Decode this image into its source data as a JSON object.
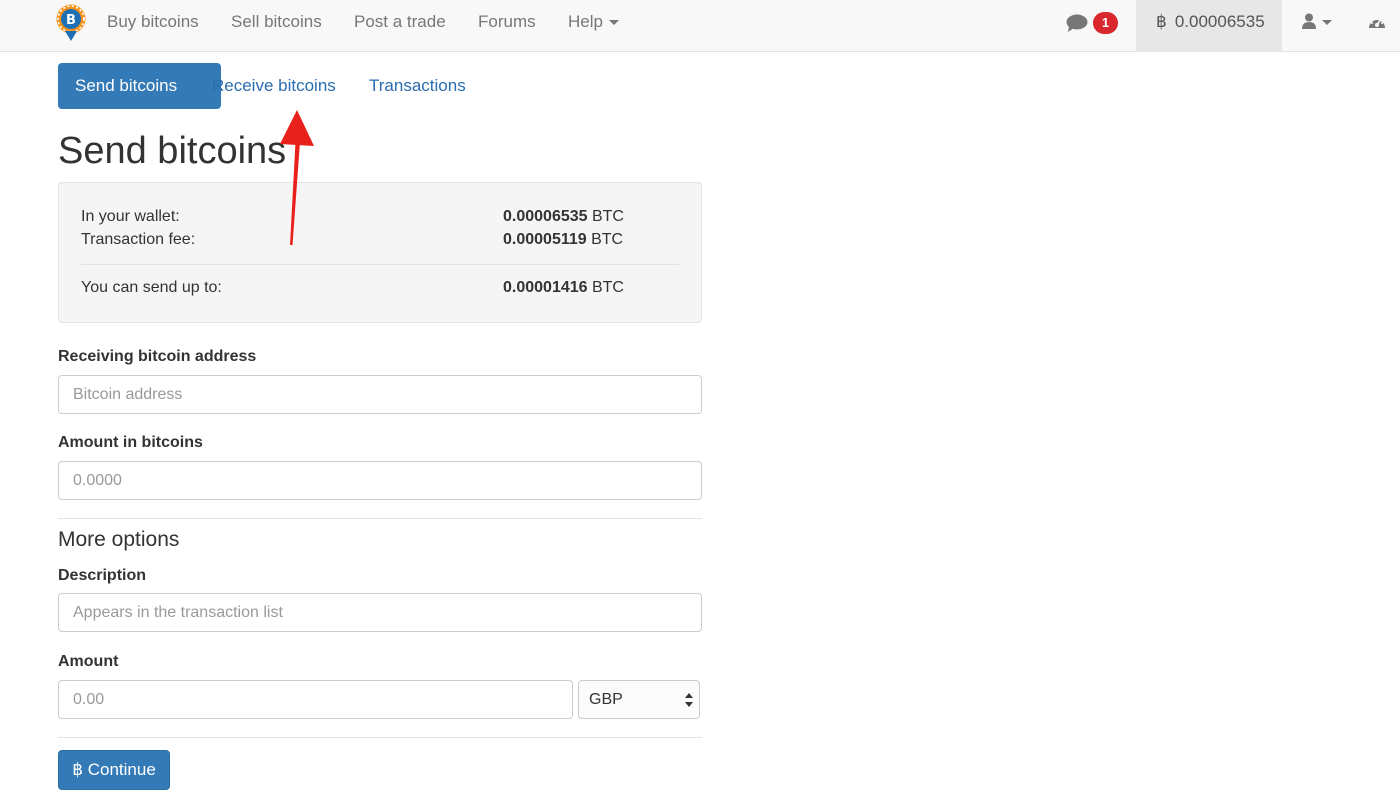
{
  "navbar": {
    "items": [
      {
        "label": "Buy bitcoins"
      },
      {
        "label": "Sell bitcoins"
      },
      {
        "label": "Post a trade"
      },
      {
        "label": "Forums"
      },
      {
        "label": "Help"
      }
    ],
    "messages_count": "1",
    "wallet_balance": "0.00006535",
    "wallet_symbol": "฿"
  },
  "pills": {
    "send": "Send bitcoins",
    "receive": "Receive bitcoins",
    "transactions": "Transactions"
  },
  "page_title": "Send bitcoins",
  "wallet": {
    "in_wallet_label": "In your wallet:",
    "in_wallet_amount": "0.00006535",
    "fee_label": "Transaction fee:",
    "fee_amount": "0.00005119",
    "can_send_label": "You can send up to:",
    "can_send_amount": "0.00001416",
    "unit": "BTC"
  },
  "form": {
    "address_label": "Receiving bitcoin address",
    "address_placeholder": "Bitcoin address",
    "amount_btc_label": "Amount in bitcoins",
    "amount_btc_placeholder": "0.0000",
    "more_options": "More options",
    "description_label": "Description",
    "description_placeholder": "Appears in the transaction list",
    "amount_label": "Amount",
    "amount_placeholder": "0.00",
    "currency": "GBP",
    "continue_label": "Continue",
    "continue_symbol": "฿"
  },
  "colors": {
    "primary": "#337ab7",
    "badge": "#d9272e",
    "annotation_arrow": "#e8211c"
  }
}
